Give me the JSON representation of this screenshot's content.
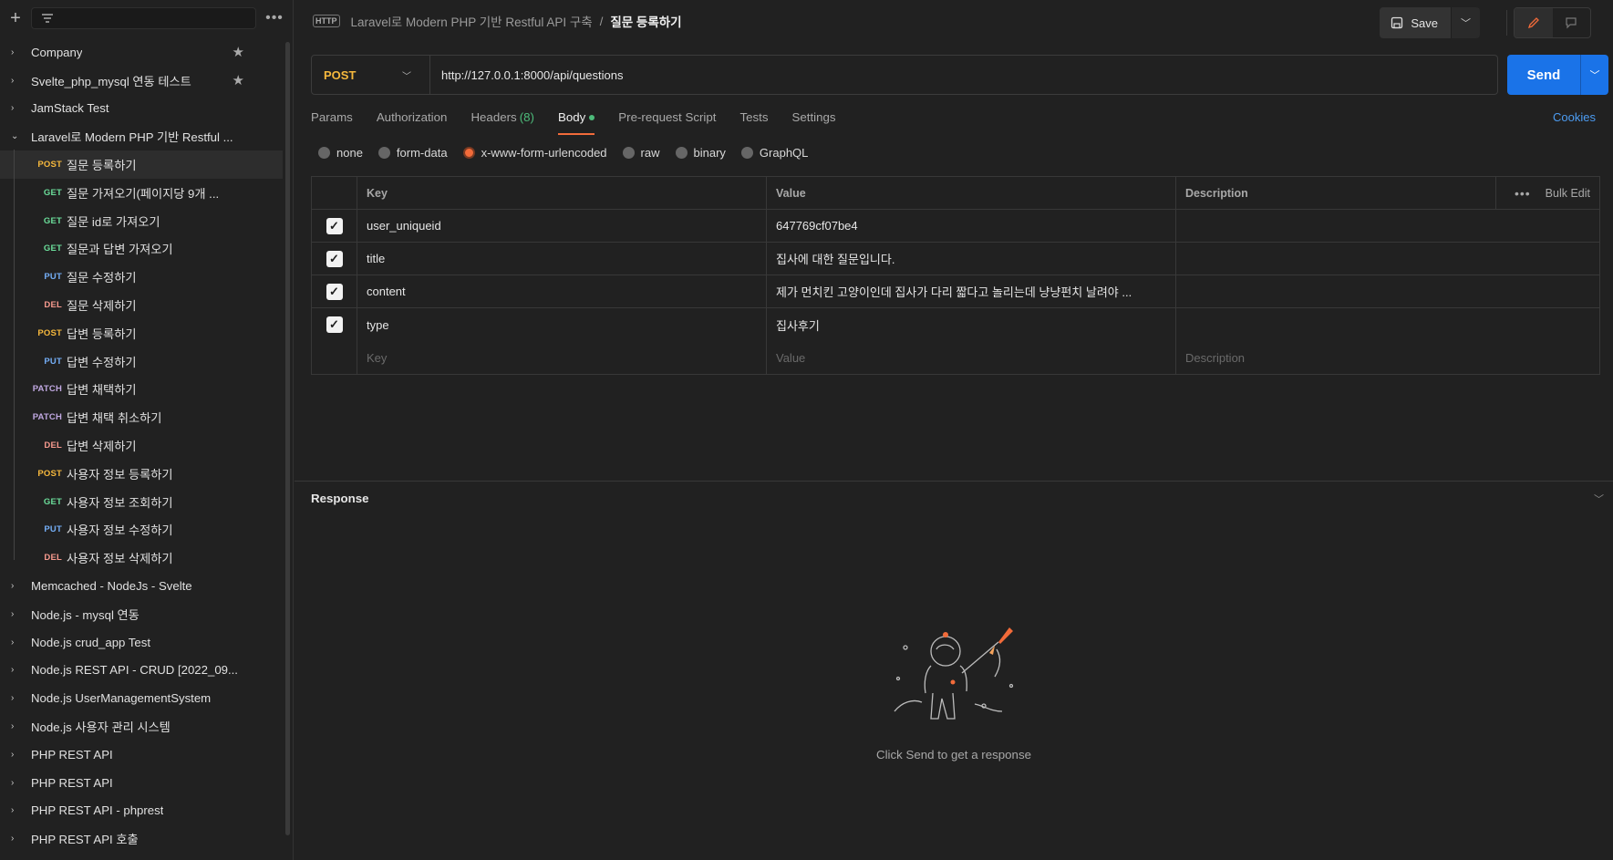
{
  "sidebar": {
    "collections_before": [
      {
        "label": "Company",
        "starred": true
      },
      {
        "label": "Svelte_php_mysql 연동 테스트",
        "starred": true
      },
      {
        "label": "JamStack Test",
        "starred": false
      }
    ],
    "open_collection": {
      "label": "Laravel로 Modern PHP 기반 Restful ..."
    },
    "requests": [
      {
        "method": "POST",
        "label": "질문 등록하기",
        "cls": "m-post",
        "selected": true
      },
      {
        "method": "GET",
        "label": "질문 가져오기(페이지당 9개 ...",
        "cls": "m-get"
      },
      {
        "method": "GET",
        "label": "질문 id로 가져오기",
        "cls": "m-get"
      },
      {
        "method": "GET",
        "label": "질문과 답변 가져오기",
        "cls": "m-get"
      },
      {
        "method": "PUT",
        "label": "질문 수정하기",
        "cls": "m-put"
      },
      {
        "method": "DEL",
        "label": "질문 삭제하기",
        "cls": "m-del"
      },
      {
        "method": "POST",
        "label": "답변 등록하기",
        "cls": "m-post"
      },
      {
        "method": "PUT",
        "label": "답변 수정하기",
        "cls": "m-put"
      },
      {
        "method": "PATCH",
        "label": "답변 채택하기",
        "cls": "m-patch"
      },
      {
        "method": "PATCH",
        "label": "답변 채택 취소하기",
        "cls": "m-patch"
      },
      {
        "method": "DEL",
        "label": "답변 삭제하기",
        "cls": "m-del"
      },
      {
        "method": "POST",
        "label": "사용자 정보 등록하기",
        "cls": "m-post"
      },
      {
        "method": "GET",
        "label": "사용자 정보 조회하기",
        "cls": "m-get"
      },
      {
        "method": "PUT",
        "label": "사용자 정보 수정하기",
        "cls": "m-put"
      },
      {
        "method": "DEL",
        "label": "사용자 정보 삭제하기",
        "cls": "m-del"
      }
    ],
    "collections_after": [
      {
        "label": "Memcached - NodeJs - Svelte"
      },
      {
        "label": "Node.js - mysql 연동"
      },
      {
        "label": "Node.js crud_app Test"
      },
      {
        "label": "Node.js REST API - CRUD [2022_09..."
      },
      {
        "label": "Node.js UserManagementSystem"
      },
      {
        "label": "Node.js 사용자 관리 시스템"
      },
      {
        "label": "PHP REST API"
      },
      {
        "label": "PHP REST API"
      },
      {
        "label": "PHP REST API - phprest"
      },
      {
        "label": "PHP REST API 호출"
      }
    ]
  },
  "header": {
    "icon_text": "HTTP",
    "breadcrumb_parent": "Laravel로 Modern PHP 기반 Restful API 구축",
    "breadcrumb_sep": "/",
    "breadcrumb_current": "질문 등록하기",
    "save_label": "Save"
  },
  "request": {
    "method": "POST",
    "url": "http://127.0.0.1:8000/api/questions",
    "send_label": "Send"
  },
  "tabs": [
    {
      "label": "Params"
    },
    {
      "label": "Authorization"
    },
    {
      "label": "Headers",
      "count": "(8)"
    },
    {
      "label": "Body",
      "active": true,
      "dot": true
    },
    {
      "label": "Pre-request Script"
    },
    {
      "label": "Tests"
    },
    {
      "label": "Settings"
    }
  ],
  "cookies_label": "Cookies",
  "body_types": [
    {
      "label": "none"
    },
    {
      "label": "form-data"
    },
    {
      "label": "x-www-form-urlencoded",
      "selected": true
    },
    {
      "label": "raw"
    },
    {
      "label": "binary"
    },
    {
      "label": "GraphQL"
    }
  ],
  "table": {
    "headers": {
      "key": "Key",
      "value": "Value",
      "description": "Description",
      "bulk_edit": "Bulk Edit"
    },
    "rows": [
      {
        "key": "user_uniqueid",
        "value": "647769cf07be4",
        "description": ""
      },
      {
        "key": "title",
        "value": "집사에 대한 질문입니다.",
        "description": ""
      },
      {
        "key": "content",
        "value": "제가 먼치킨 고양이인데 집사가 다리 짧다고 놀리는데 냥냥펀치 날려야 ...",
        "description": ""
      },
      {
        "key": "type",
        "value": "집사후기",
        "description": ""
      }
    ],
    "placeholders": {
      "key": "Key",
      "value": "Value",
      "description": "Description"
    }
  },
  "response": {
    "title": "Response",
    "empty_message": "Click Send to get a response"
  },
  "colors": {
    "accent": "#f26b3a",
    "send": "#1a73e8",
    "post": "#f5b83d",
    "get": "#6bdd9a",
    "put": "#74aef6",
    "del": "#f79a8e",
    "patch": "#c0a8e1"
  }
}
